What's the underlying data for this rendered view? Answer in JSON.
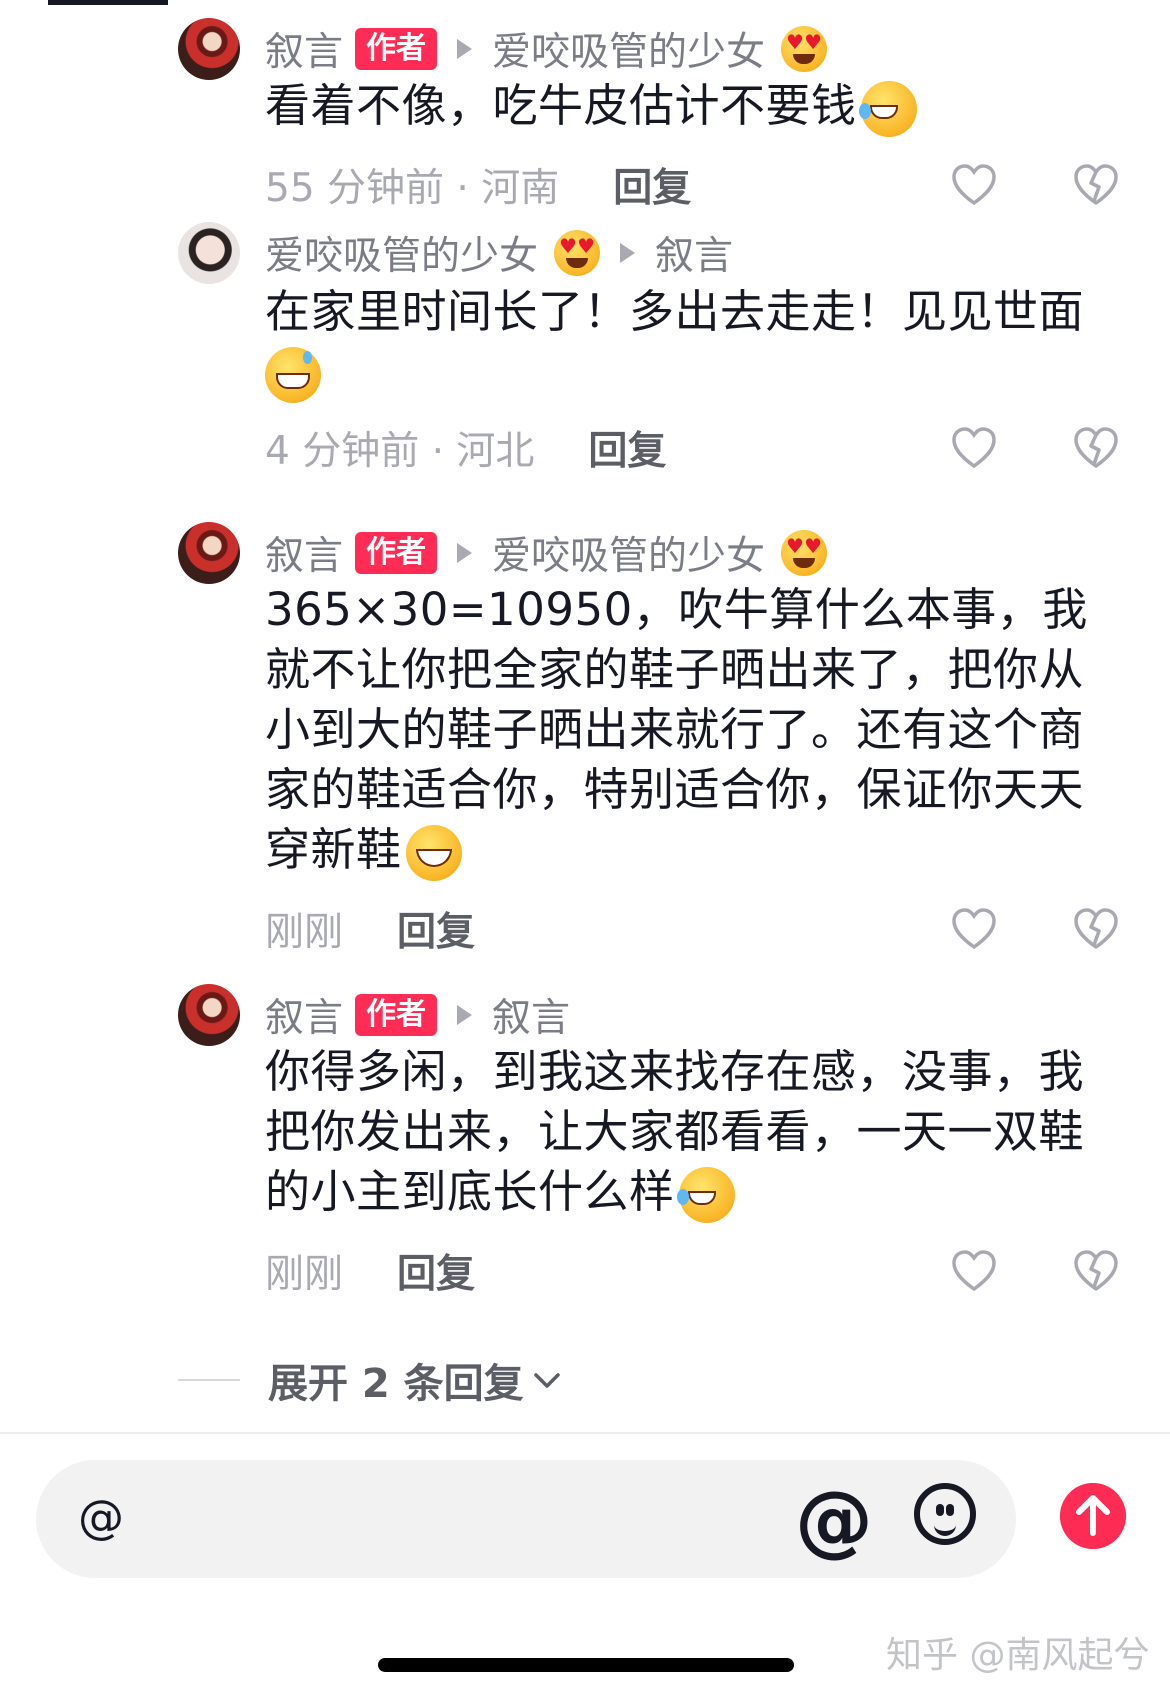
{
  "comments": [
    {
      "author": "叙言",
      "badge": "作者",
      "reply_to": "爱咬吸管的少女",
      "reply_to_emoji": "heart-eyes-emoji",
      "text": "看着不像，吃牛皮估计不要钱",
      "text_emoji": "rolling-laughing-emoji",
      "time_location": "55 分钟前 · 河南",
      "reply_label": "回复"
    },
    {
      "author": "爱咬吸管的少女",
      "author_emoji": "heart-eyes-emoji",
      "reply_to": "叙言",
      "text": "在家里时间长了！多出去走走！见见世面",
      "text_emoji": "grinning-sweat-emoji",
      "time_location": "4 分钟前 · 河北",
      "reply_label": "回复"
    },
    {
      "author": "叙言",
      "badge": "作者",
      "reply_to": "爱咬吸管的少女",
      "reply_to_emoji": "heart-eyes-emoji",
      "text": "365×30=10950，吹牛算什么本事，我就不让你把全家的鞋子晒出来了，把你从小到大的鞋子晒出来就行了。还有这个商家的鞋适合你，特别适合你，保证你天天穿新鞋",
      "text_emoji": "grinning-emoji",
      "time_location": "刚刚",
      "reply_label": "回复"
    },
    {
      "author": "叙言",
      "badge": "作者",
      "reply_to": "叙言",
      "text": "你得多闲，到我这来找存在感，没事，我把你发出来，让大家都看看，一天一双鞋的小主到底长什么样",
      "text_emoji": "rolling-laughing-emoji",
      "time_location": "刚刚",
      "reply_label": "回复"
    }
  ],
  "expand_label": "展开 2 条回复",
  "input": {
    "prefix": "@",
    "placeholder": ""
  },
  "icons": {
    "like": "heart-outline-icon",
    "dislike": "broken-heart-icon",
    "mention": "at-icon",
    "emoji": "smile-icon",
    "send": "send-arrow-icon"
  },
  "colors": {
    "accent": "#fe2c55",
    "secondary_text": "#a9aab1",
    "primary_text": "#161823"
  },
  "watermark": "知乎 @南风起兮"
}
